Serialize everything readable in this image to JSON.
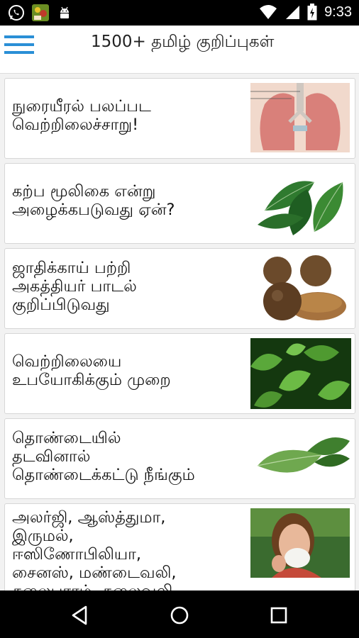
{
  "status_bar": {
    "time": "9:33",
    "left_icons": [
      "whatsapp-icon",
      "app-thumbnail-icon",
      "android-icon"
    ],
    "right_icons": [
      "wifi-icon",
      "signal-icon",
      "battery-icon"
    ]
  },
  "app_bar": {
    "title": "1500+ தமிழ் குறிப்புகள்",
    "menu_icon": "hamburger-menu-icon",
    "accent_color": "#2a8fd6"
  },
  "articles": [
    {
      "lines": [
        "நுரையீரல் பலப்பட",
        "வெற்றிலைச்சாறு!"
      ],
      "image": "lungs-image"
    },
    {
      "lines": [
        "கற்ப மூலிகை என்று",
        "அழைக்கபடுவது ஏன்?"
      ],
      "image": "betel-leaves-image"
    },
    {
      "lines": [
        "ஜாதிக்காய் பற்றி",
        "அகத்தியர் பாடல்",
        "குறிப்பிடுவது"
      ],
      "image": "nutmeg-image"
    },
    {
      "lines": [
        "வெற்றிலையை",
        "உபயோகிக்கும் முறை"
      ],
      "image": "betel-plant-image"
    },
    {
      "lines": [
        "தொண்டையில்",
        "தடவினால்",
        "தொண்டைக்கட்டு நீங்கும்"
      ],
      "image": "betel-leaf-bundle-image"
    },
    {
      "lines": [
        "அலர்ஜி, ஆஸ்த்துமா,",
        "இருமல்,",
        "ஈஸிணோபிலியா,",
        "சைனஸ், மண்டைவலி,",
        "தலைபாரம், தலைவலி"
      ],
      "image": "sneezing-woman-image"
    }
  ],
  "nav_bar": {
    "buttons": [
      "back-icon",
      "home-icon",
      "recents-icon"
    ]
  }
}
